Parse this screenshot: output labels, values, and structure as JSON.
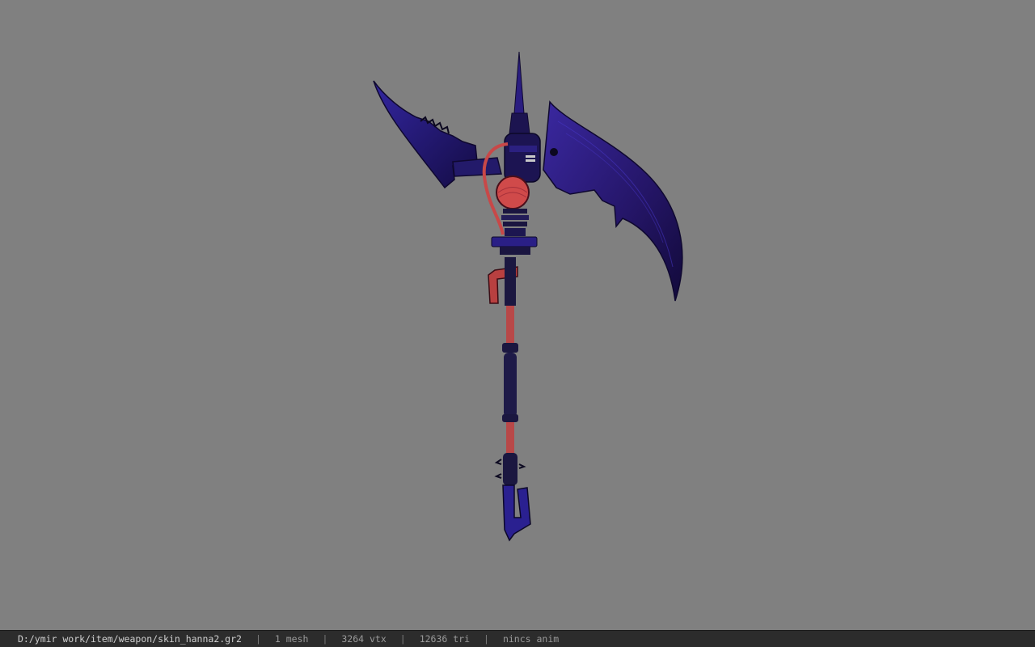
{
  "viewer": {
    "background_color": "#808080",
    "model_colors": {
      "blade": "#2a1a7a",
      "blade_edge": "#1a1050",
      "accent": "#d04a4a",
      "shaft": "#1b1740"
    },
    "model_icon": "scythe-model-icon"
  },
  "status_bar": {
    "file_path": "D:/ymir work/item/weapon/skin_hanna2.gr2",
    "separator": "|",
    "mesh_count": "1 mesh",
    "vertex_count": "3264 vtx",
    "triangle_count": "12636 tri",
    "animation": "nincs anim"
  }
}
